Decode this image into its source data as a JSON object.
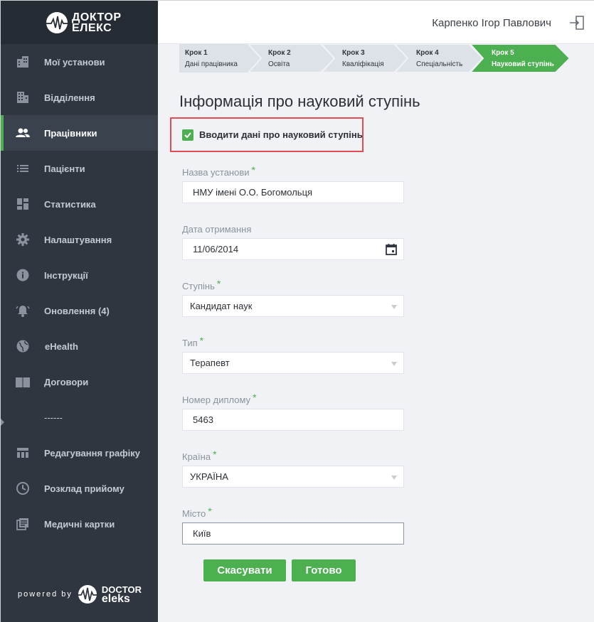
{
  "brand": {
    "logo_line1": "ДОКТОР",
    "logo_line2": "ЕЛЕКС",
    "powered_text": "powered by",
    "powered_brand_line1": "DOCTOR",
    "powered_brand_line2": "eleks"
  },
  "sidebar": {
    "items": [
      {
        "label": "Мої установи",
        "icon": "buildings-icon"
      },
      {
        "label": "Відділення",
        "icon": "building-icon"
      },
      {
        "label": "Працівники",
        "icon": "people-icon",
        "active": true
      },
      {
        "label": "Пацієнти",
        "icon": "list-icon"
      },
      {
        "label": "Статистика",
        "icon": "dashboard-icon"
      },
      {
        "label": "Налаштування",
        "icon": "gear-icon"
      },
      {
        "label": "Інструкції",
        "icon": "info-icon"
      },
      {
        "label": "Оновлення (4)",
        "icon": "bell-icon"
      },
      {
        "label": "eHealth",
        "icon": "globe-icon"
      },
      {
        "label": "Договори",
        "icon": "book-icon"
      }
    ],
    "separator": "------",
    "items2": [
      {
        "label": "Редагування графіку",
        "icon": "table-icon"
      },
      {
        "label": "Розклад прийому",
        "icon": "clock-icon"
      },
      {
        "label": "Медичні картки",
        "icon": "records-icon"
      }
    ]
  },
  "header": {
    "user_name": "Карпенко Ігор Павлович"
  },
  "steps": [
    {
      "num": "Крок 1",
      "name": "Дані працівника"
    },
    {
      "num": "Крок 2",
      "name": "Освіта"
    },
    {
      "num": "Крок 3",
      "name": "Кваліфікація"
    },
    {
      "num": "Крок 4",
      "name": "Спеціальність"
    },
    {
      "num": "Крок 5",
      "name": "Науковий ступінь",
      "active": true
    }
  ],
  "form": {
    "title": "Інформація про науковий ступінь",
    "checkbox_label": "Вводити дані про науковий ступінь",
    "checkbox_checked": true,
    "fields": {
      "institution": {
        "label": "Назва установи",
        "value": "НМУ імені О.О. Богомольця"
      },
      "date": {
        "label": "Дата отримання",
        "value": "11/06/2014"
      },
      "degree": {
        "label": "Ступінь",
        "value": "Кандидат наук"
      },
      "type": {
        "label": "Тип",
        "value": "Терапевт"
      },
      "diploma": {
        "label": "Номер диплому",
        "value": "5463"
      },
      "country": {
        "label": "Країна",
        "value": "УКРАЇНА"
      },
      "city": {
        "label": "Місто",
        "value": "Київ"
      }
    },
    "required_mark": "*",
    "cancel_label": "Скасувати",
    "done_label": "Готово"
  },
  "colors": {
    "sidebar_bg": "#2f3640",
    "accent_green": "#4caf50",
    "highlight_red": "#e34b55",
    "content_bg": "#f0f2f5"
  }
}
